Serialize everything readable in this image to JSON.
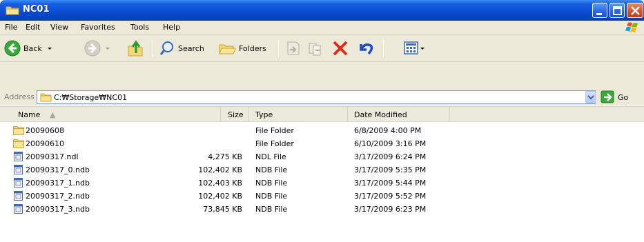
{
  "window": {
    "title": "NC01"
  },
  "menu": [
    "File",
    "Edit",
    "View",
    "Favorites",
    "Tools",
    "Help"
  ],
  "toolbar": {
    "back_label": "Back",
    "search_label": "Search",
    "folders_label": "Folders"
  },
  "address": {
    "label": "Address",
    "value": "C:\\Storage\\NC01",
    "display": "C:₩Storage₩NC01",
    "go_label": "Go"
  },
  "columns": [
    "Name",
    "Size",
    "Type",
    "Date Modified"
  ],
  "files": [
    {
      "name": "20090608",
      "size": "",
      "type": "File Folder",
      "date": "6/8/2009 4:00 PM",
      "icon": "folder"
    },
    {
      "name": "20090610",
      "size": "",
      "type": "File Folder",
      "date": "6/10/2009 3:16 PM",
      "icon": "folder"
    },
    {
      "name": "20090317.ndl",
      "size": "4,275 KB",
      "type": "NDL File",
      "date": "3/17/2009 6:24 PM",
      "icon": "file"
    },
    {
      "name": "20090317_0.ndb",
      "size": "102,402 KB",
      "type": "NDB File",
      "date": "3/17/2009 5:35 PM",
      "icon": "file"
    },
    {
      "name": "20090317_1.ndb",
      "size": "102,403 KB",
      "type": "NDB File",
      "date": "3/17/2009 5:44 PM",
      "icon": "file"
    },
    {
      "name": "20090317_2.ndb",
      "size": "102,402 KB",
      "type": "NDB File",
      "date": "3/17/2009 5:52 PM",
      "icon": "file"
    },
    {
      "name": "20090317_3.ndb",
      "size": "73,845 KB",
      "type": "NDB File",
      "date": "3/17/2009 6:23 PM",
      "icon": "file"
    }
  ],
  "colors": {
    "titlebar": "#0a4ed6",
    "chrome": "#ece9d8",
    "close_button": "#d9532c"
  }
}
